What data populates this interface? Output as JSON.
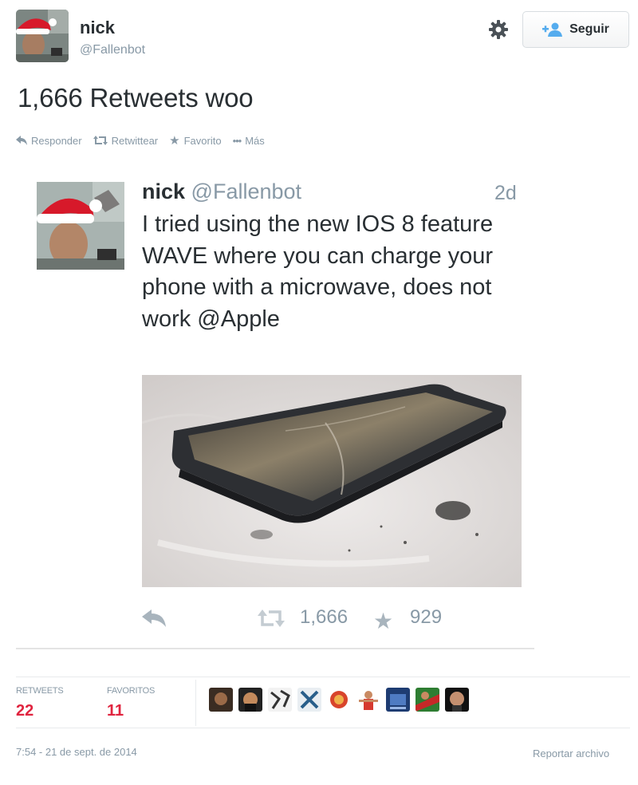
{
  "author": {
    "display_name": "nick",
    "handle": "@Fallenbot",
    "avatar_icon": "avatar-santa-hat"
  },
  "follow_button": {
    "label": "Seguir",
    "icon": "add-user-icon"
  },
  "settings_icon": "gear-icon",
  "tweet": {
    "text": "1,666 Retweets woo",
    "actions": [
      {
        "icon": "reply-icon",
        "label": "Responder"
      },
      {
        "icon": "retweet-icon",
        "label": "Retwittear"
      },
      {
        "icon": "star-icon",
        "label": "Favorito"
      },
      {
        "icon": "more-icon",
        "label": "Más"
      }
    ]
  },
  "embedded": {
    "name": "nick",
    "handle": "@Fallenbot",
    "time": "2d",
    "text": "I tried using the new IOS 8 feature WAVE where you can charge your phone with a microwave, does not work @Apple",
    "retweets": "1,666",
    "favorites": "929"
  },
  "stats": {
    "retweets_label": "RETWEETS",
    "retweets_value": "22",
    "favorites_label": "FAVORITOS",
    "favorites_value": "11"
  },
  "footer": {
    "date": "7:54 - 21 de sept. de 2014",
    "report": "Reportar archivo"
  },
  "colors": {
    "accent_red": "#e0243f",
    "muted": "#8899a6",
    "text": "#292f33",
    "link_blue": "#55acee"
  }
}
